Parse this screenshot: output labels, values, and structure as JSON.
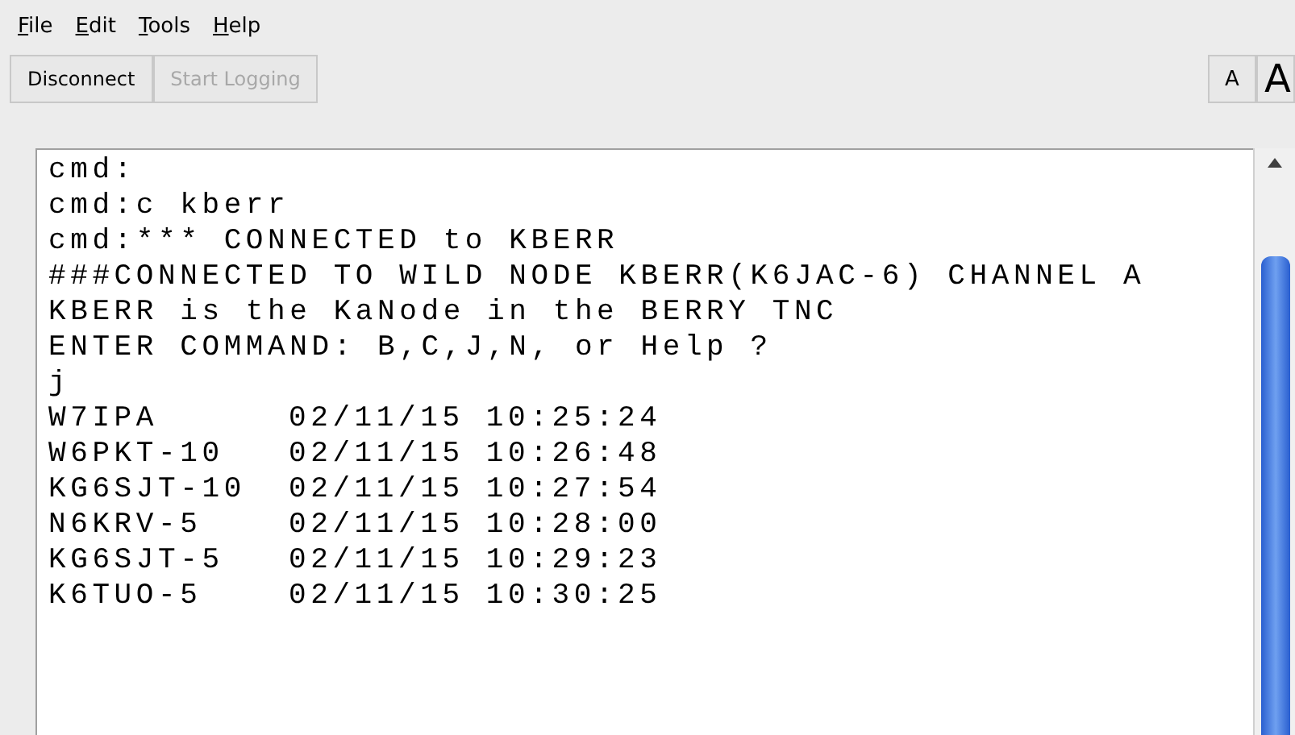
{
  "menu": [
    "File",
    "Edit",
    "Tools",
    "Help"
  ],
  "toolbar": {
    "buttons": [
      {
        "label": "Disconnect",
        "disabled": false
      },
      {
        "label": "Start Logging",
        "disabled": true
      }
    ],
    "font_buttons": [
      {
        "label": "A",
        "kind": "small"
      },
      {
        "label": "A",
        "kind": "large"
      }
    ]
  },
  "terminal": {
    "lines": [
      {
        "kind": "text",
        "text": "cmd:"
      },
      {
        "kind": "text",
        "text": "cmd:c kberr"
      },
      {
        "kind": "text",
        "text": "cmd:*** CONNECTED to KBERR"
      },
      {
        "kind": "text",
        "text": "###CONNECTED TO WILD NODE KBERR(K6JAC-6) CHANNEL A"
      },
      {
        "kind": "text",
        "text": "KBERR is the KaNode in the BERRY TNC"
      },
      {
        "kind": "text",
        "text": "ENTER COMMAND: B,C,J,N, or Help ?"
      },
      {
        "kind": "text",
        "text": "j"
      },
      {
        "kind": "entry",
        "callsign": "W7IPA",
        "time": "02/11/15 10:25:24"
      },
      {
        "kind": "entry",
        "callsign": "W6PKT-10",
        "time": "02/11/15 10:26:48"
      },
      {
        "kind": "entry",
        "callsign": "KG6SJT-10",
        "time": "02/11/15 10:27:54"
      },
      {
        "kind": "entry",
        "callsign": "N6KRV-5",
        "time": "02/11/15 10:28:00"
      },
      {
        "kind": "entry",
        "callsign": "KG6SJT-5",
        "time": "02/11/15 10:29:23"
      },
      {
        "kind": "entry",
        "callsign": "K6TUO-5",
        "time": "02/11/15 10:30:25"
      }
    ]
  }
}
